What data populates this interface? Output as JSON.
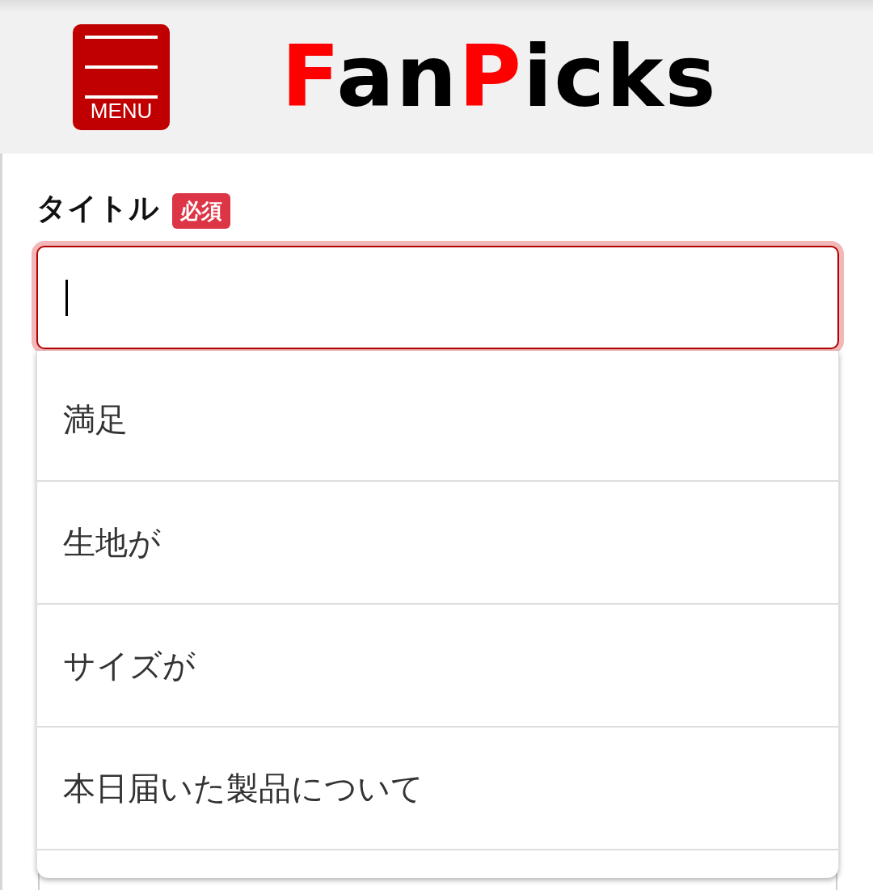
{
  "header": {
    "menu_button": {
      "label": "MENU"
    },
    "logo": {
      "parts": [
        {
          "text": "F",
          "color": "#ff0000"
        },
        {
          "text": "an",
          "color": "#000000"
        },
        {
          "text": "P",
          "color": "#ff0000"
        },
        {
          "text": "icks",
          "color": "#000000"
        }
      ]
    }
  },
  "form": {
    "field": {
      "label": "タイトル",
      "badge": "必須",
      "focused": true
    },
    "suggestions": [
      "満足",
      "生地が",
      "サイズが",
      "本日届いた製品について"
    ]
  }
}
